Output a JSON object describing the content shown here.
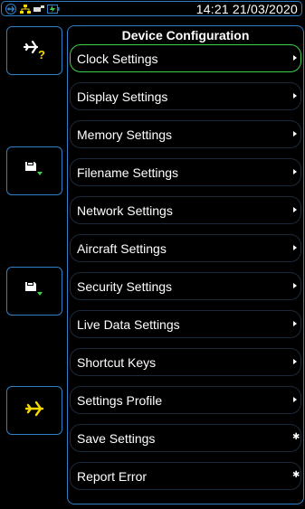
{
  "status_bar": {
    "icons": [
      "airplane-icon",
      "network-icon",
      "usb-icon",
      "battery-charging-icon"
    ],
    "time_date": "14:21 21/03/2020"
  },
  "side_buttons": [
    {
      "name": "aircraft-unknown-button",
      "icon": "airplane-question-icon"
    },
    {
      "name": "save-download-button",
      "icon": "floppy-download-icon"
    },
    {
      "name": "save-upload-button",
      "icon": "floppy-download-icon"
    },
    {
      "name": "flight-button",
      "icon": "airplane-icon"
    }
  ],
  "panel": {
    "title": "Device Configuration",
    "items": [
      {
        "label": "Clock Settings",
        "indicator": "arrow",
        "selected": true
      },
      {
        "label": "Display Settings",
        "indicator": "arrow"
      },
      {
        "label": "Memory Settings",
        "indicator": "arrow"
      },
      {
        "label": "Filename Settings",
        "indicator": "arrow"
      },
      {
        "label": "Network Settings",
        "indicator": "arrow"
      },
      {
        "label": "Aircraft Settings",
        "indicator": "arrow"
      },
      {
        "label": "Security Settings",
        "indicator": "arrow"
      },
      {
        "label": "Live Data Settings",
        "indicator": "arrow"
      },
      {
        "label": "Shortcut Keys",
        "indicator": "arrow"
      },
      {
        "label": "Settings Profile",
        "indicator": "arrow"
      },
      {
        "label": "Save Settings",
        "indicator": "dot"
      },
      {
        "label": "Report Error",
        "indicator": "dot"
      }
    ]
  },
  "colors": {
    "accent_blue": "#2f80c8",
    "selected_green": "#3fd04a",
    "airplane_yellow": "#f5d800",
    "download_green": "#3fd04a"
  }
}
